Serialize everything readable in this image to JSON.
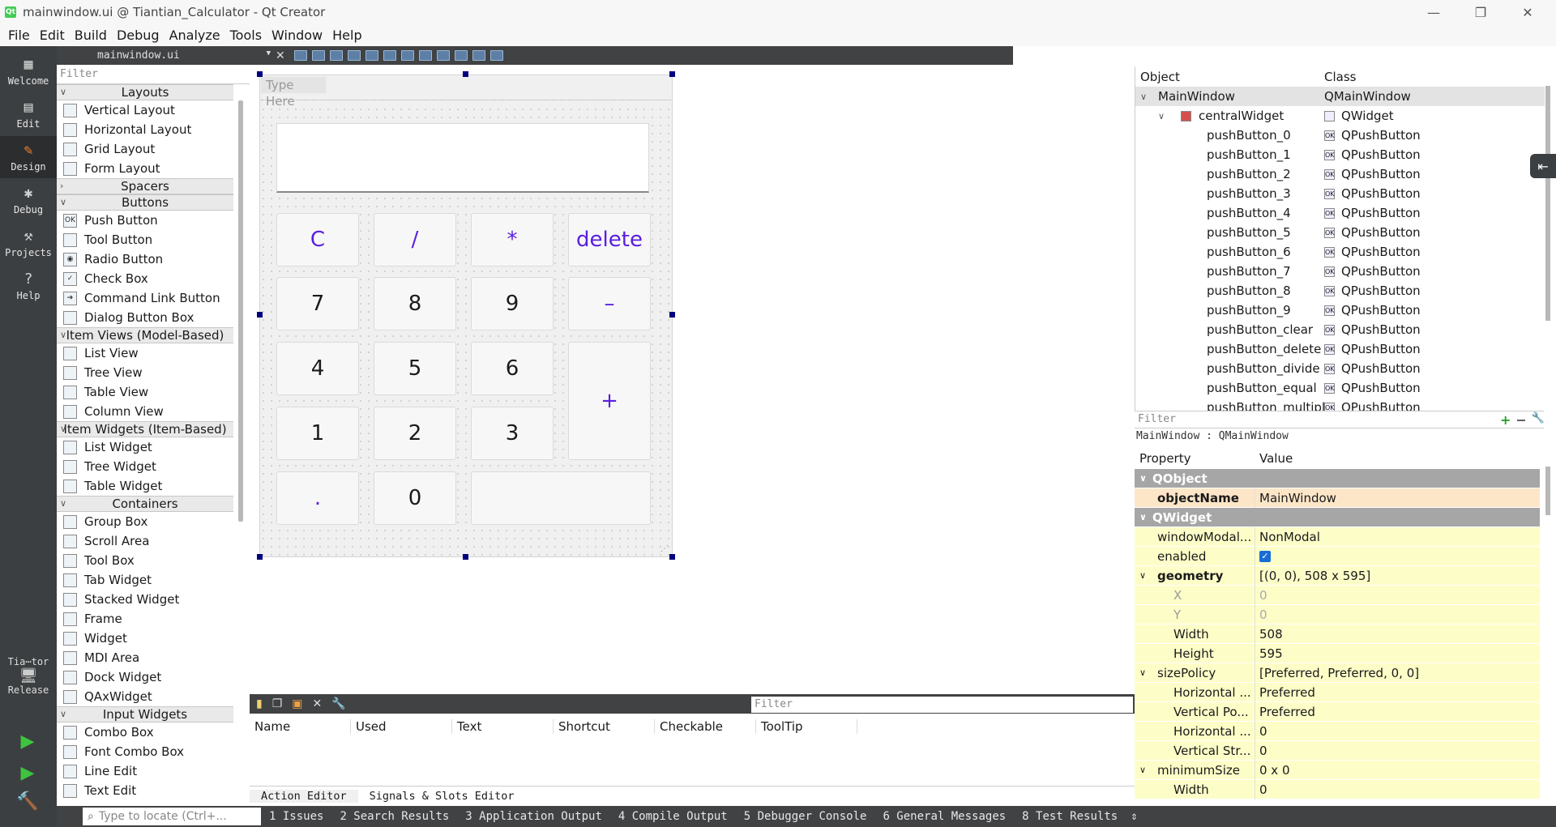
{
  "window": {
    "title": "mainwindow.ui @ Tiantian_Calculator - Qt Creator",
    "controls": [
      "—",
      "❐",
      "✕"
    ]
  },
  "menu": [
    "File",
    "Edit",
    "Build",
    "Debug",
    "Analyze",
    "Tools",
    "Window",
    "Help"
  ],
  "modes": [
    {
      "label": "Welcome",
      "icon": "grid-icon"
    },
    {
      "label": "Edit",
      "icon": "document-icon"
    },
    {
      "label": "Design",
      "icon": "pencil-icon",
      "active": true
    },
    {
      "label": "Debug",
      "icon": "bug-icon"
    },
    {
      "label": "Projects",
      "icon": "wrench-icon"
    },
    {
      "label": "Help",
      "icon": "help-icon"
    }
  ],
  "kit": {
    "project": "Tia⋯tor",
    "config": "Release"
  },
  "editor_toolbar": {
    "file": "mainwindow.ui"
  },
  "widget_box": {
    "filter_placeholder": "Filter",
    "categories": [
      {
        "name": "Layouts",
        "expanded": true,
        "items": [
          {
            "label": "Vertical Layout",
            "icon": "vertical-layout-icon"
          },
          {
            "label": "Horizontal Layout",
            "icon": "horizontal-layout-icon"
          },
          {
            "label": "Grid Layout",
            "icon": "grid-layout-icon"
          },
          {
            "label": "Form Layout",
            "icon": "form-layout-icon"
          }
        ]
      },
      {
        "name": "Spacers",
        "expanded": false,
        "items": []
      },
      {
        "name": "Buttons",
        "expanded": true,
        "items": [
          {
            "label": "Push Button",
            "icon": "push-button-icon"
          },
          {
            "label": "Tool Button",
            "icon": "tool-button-icon"
          },
          {
            "label": "Radio Button",
            "icon": "radio-button-icon"
          },
          {
            "label": "Check Box",
            "icon": "check-box-icon"
          },
          {
            "label": "Command Link Button",
            "icon": "command-link-icon"
          },
          {
            "label": "Dialog Button Box",
            "icon": "dialog-button-box-icon"
          }
        ]
      },
      {
        "name": "Item Views (Model-Based)",
        "expanded": true,
        "items": [
          {
            "label": "List View",
            "icon": "list-view-icon"
          },
          {
            "label": "Tree View",
            "icon": "tree-view-icon"
          },
          {
            "label": "Table View",
            "icon": "table-view-icon"
          },
          {
            "label": "Column View",
            "icon": "column-view-icon"
          }
        ]
      },
      {
        "name": "Item Widgets (Item-Based)",
        "expanded": true,
        "items": [
          {
            "label": "List Widget",
            "icon": "list-widget-icon"
          },
          {
            "label": "Tree Widget",
            "icon": "tree-widget-icon"
          },
          {
            "label": "Table Widget",
            "icon": "table-widget-icon"
          }
        ]
      },
      {
        "name": "Containers",
        "expanded": true,
        "items": [
          {
            "label": "Group Box",
            "icon": "group-box-icon"
          },
          {
            "label": "Scroll Area",
            "icon": "scroll-area-icon"
          },
          {
            "label": "Tool Box",
            "icon": "tool-box-icon"
          },
          {
            "label": "Tab Widget",
            "icon": "tab-widget-icon"
          },
          {
            "label": "Stacked Widget",
            "icon": "stacked-widget-icon"
          },
          {
            "label": "Frame",
            "icon": "frame-icon"
          },
          {
            "label": "Widget",
            "icon": "widget-icon"
          },
          {
            "label": "MDI Area",
            "icon": "mdi-area-icon"
          },
          {
            "label": "Dock Widget",
            "icon": "dock-widget-icon"
          },
          {
            "label": "QAxWidget",
            "icon": "qaxwidget-icon"
          }
        ]
      },
      {
        "name": "Input Widgets",
        "expanded": true,
        "items": [
          {
            "label": "Combo Box",
            "icon": "combo-box-icon"
          },
          {
            "label": "Font Combo Box",
            "icon": "font-combo-box-icon"
          },
          {
            "label": "Line Edit",
            "icon": "line-edit-icon"
          },
          {
            "label": "Text Edit",
            "icon": "text-edit-icon"
          }
        ]
      }
    ]
  },
  "form": {
    "menu_placeholder": "Type Here",
    "buttons": [
      {
        "label": "C",
        "op": true
      },
      {
        "label": "/",
        "op": true
      },
      {
        "label": "*",
        "op": true
      },
      {
        "label": "delete",
        "op": true
      },
      {
        "label": "7",
        "op": false
      },
      {
        "label": "8",
        "op": false
      },
      {
        "label": "9",
        "op": false
      },
      {
        "label": "–",
        "op": true
      },
      {
        "label": "4",
        "op": false
      },
      {
        "label": "5",
        "op": false
      },
      {
        "label": "6",
        "op": false
      },
      {
        "label": "+",
        "op": true
      },
      {
        "label": "1",
        "op": false
      },
      {
        "label": "2",
        "op": false
      },
      {
        "label": "3",
        "op": false
      },
      {
        "label": ".",
        "op": true
      },
      {
        "label": "0",
        "op": false
      },
      {
        "label": "",
        "op": false
      }
    ]
  },
  "action_editor": {
    "filter_placeholder": "Filter",
    "columns": [
      "Name",
      "Used",
      "Text",
      "Shortcut",
      "Checkable",
      "ToolTip"
    ],
    "tabs": [
      "Action Editor",
      "Signals & Slots Editor"
    ]
  },
  "object_inspector": {
    "columns": [
      "Object",
      "Class"
    ],
    "rows": [
      {
        "name": "MainWindow",
        "cls": "QMainWindow",
        "depth": 0,
        "expanded": true,
        "selected": true
      },
      {
        "name": "centralWidget",
        "cls": "QWidget",
        "depth": 1,
        "expanded": true
      },
      {
        "name": "pushButton_0",
        "cls": "QPushButton",
        "depth": 2
      },
      {
        "name": "pushButton_1",
        "cls": "QPushButton",
        "depth": 2
      },
      {
        "name": "pushButton_2",
        "cls": "QPushButton",
        "depth": 2
      },
      {
        "name": "pushButton_3",
        "cls": "QPushButton",
        "depth": 2
      },
      {
        "name": "pushButton_4",
        "cls": "QPushButton",
        "depth": 2
      },
      {
        "name": "pushButton_5",
        "cls": "QPushButton",
        "depth": 2
      },
      {
        "name": "pushButton_6",
        "cls": "QPushButton",
        "depth": 2
      },
      {
        "name": "pushButton_7",
        "cls": "QPushButton",
        "depth": 2
      },
      {
        "name": "pushButton_8",
        "cls": "QPushButton",
        "depth": 2
      },
      {
        "name": "pushButton_9",
        "cls": "QPushButton",
        "depth": 2
      },
      {
        "name": "pushButton_clear",
        "cls": "QPushButton",
        "depth": 2
      },
      {
        "name": "pushButton_delete",
        "cls": "QPushButton",
        "depth": 2
      },
      {
        "name": "pushButton_divide",
        "cls": "QPushButton",
        "depth": 2
      },
      {
        "name": "pushButton_equal",
        "cls": "QPushButton",
        "depth": 2
      },
      {
        "name": "pushButton_multiply",
        "cls": "QPushButton",
        "depth": 2
      }
    ]
  },
  "property_editor": {
    "filter_placeholder": "Filter",
    "class_label": "MainWindow : QMainWindow",
    "columns": [
      "Property",
      "Value"
    ],
    "rows": [
      {
        "kind": "section",
        "name": "QObject"
      },
      {
        "kind": "prop",
        "name": "objectName",
        "value": "MainWindow",
        "bold": true,
        "tone": "orange",
        "depth": 0
      },
      {
        "kind": "section",
        "name": "QWidget"
      },
      {
        "kind": "prop",
        "name": "windowModal...",
        "value": "NonModal",
        "tone": "yellow",
        "depth": 0
      },
      {
        "kind": "prop",
        "name": "enabled",
        "value": "",
        "checkbox": true,
        "tone": "yellow",
        "depth": 0
      },
      {
        "kind": "prop",
        "name": "geometry",
        "value": "[(0, 0), 508 x 595]",
        "bold": true,
        "expander": true,
        "tone": "yellow",
        "depth": 0
      },
      {
        "kind": "prop",
        "name": "X",
        "value": "0",
        "gray": true,
        "tone": "yellow",
        "depth": 1
      },
      {
        "kind": "prop",
        "name": "Y",
        "value": "0",
        "gray": true,
        "tone": "yellow",
        "depth": 1
      },
      {
        "kind": "prop",
        "name": "Width",
        "value": "508",
        "tone": "yellow",
        "depth": 1
      },
      {
        "kind": "prop",
        "name": "Height",
        "value": "595",
        "tone": "yellow",
        "depth": 1
      },
      {
        "kind": "prop",
        "name": "sizePolicy",
        "value": "[Preferred, Preferred, 0, 0]",
        "expander": true,
        "tone": "yellow",
        "depth": 0
      },
      {
        "kind": "prop",
        "name": "Horizontal ...",
        "value": "Preferred",
        "tone": "yellow",
        "depth": 1
      },
      {
        "kind": "prop",
        "name": "Vertical Po...",
        "value": "Preferred",
        "tone": "yellow",
        "depth": 1
      },
      {
        "kind": "prop",
        "name": "Horizontal ...",
        "value": "0",
        "tone": "yellow",
        "depth": 1
      },
      {
        "kind": "prop",
        "name": "Vertical Str...",
        "value": "0",
        "tone": "yellow",
        "depth": 1
      },
      {
        "kind": "prop",
        "name": "minimumSize",
        "value": "0 x 0",
        "expander": true,
        "tone": "yellow",
        "depth": 0
      },
      {
        "kind": "prop",
        "name": "Width",
        "value": "0",
        "tone": "yellow",
        "depth": 1
      }
    ]
  },
  "status_bar": {
    "locator_placeholder": "Type to locate (Ctrl+...",
    "panes": [
      "1 Issues",
      "2 Search Results",
      "3 Application Output",
      "4 Compile Output",
      "5 Debugger Console",
      "6 General Messages",
      "8 Test Results"
    ]
  },
  "colors": {
    "accent_button_text": "#5a1ee0",
    "mode_active_icon": "#f08030",
    "selection_handle": "#00007f"
  }
}
